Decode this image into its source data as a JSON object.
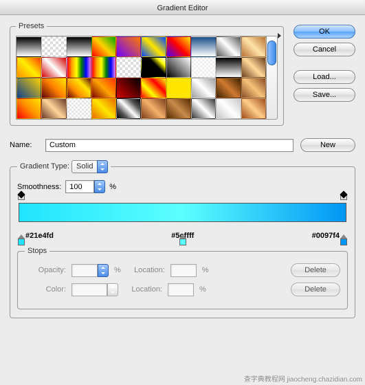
{
  "window": {
    "title": "Gradient Editor"
  },
  "presets": {
    "legend": "Presets"
  },
  "buttons": {
    "ok": "OK",
    "cancel": "Cancel",
    "load": "Load...",
    "save": "Save...",
    "new": "New",
    "delete": "Delete"
  },
  "name": {
    "label": "Name:",
    "value": "Custom"
  },
  "gtype": {
    "legend": "Gradient Type:",
    "value": "Solid"
  },
  "smoothness": {
    "label": "Smoothness:",
    "value": "100",
    "unit": "%"
  },
  "gradient": {
    "colors": [
      "#21e4fd",
      "#5cffff",
      "#0097f4"
    ],
    "labels": [
      "#21e4fd",
      "#5cffff",
      "#0097f4"
    ]
  },
  "stops": {
    "legend": "Stops",
    "opacity_label": "Opacity:",
    "color_label": "Color:",
    "location_label": "Location:",
    "opacity_value": "",
    "color_value": "",
    "loc1_value": "",
    "loc2_value": "",
    "unit": "%"
  },
  "footer": "查字典教程网 jiaocheng.chazidian.com",
  "swatch_css": [
    "linear-gradient(#000,#fff)",
    "repeating-conic-gradient(#fff 0 25%, #ddd 0 50%) 0/8px 8px",
    "linear-gradient(#000,#fff)",
    "linear-gradient(45deg,#ff0000,#ffd200,#00a600)",
    "linear-gradient(45deg,#6f00ff,#ff7a00)",
    "linear-gradient(45deg,#0044ff,#ffe600,#0044ff)",
    "linear-gradient(45deg,#4a00ff,#ff0000,#ffec00)",
    "linear-gradient(#1a4e8a,#fff)",
    "linear-gradient(45deg,#555,#fff 50%,#555)",
    "linear-gradient(45deg,#b87333,#ffe3aa,#b87333)",
    "linear-gradient(45deg,#ff8c00,#ffef00,#ff3c00)",
    "linear-gradient(45deg,#d30000,#fff,#d30000)",
    "linear-gradient(90deg,red,orange,yellow,green,blue,violet)",
    "linear-gradient(90deg,red,orange,yellow,green,blue,violet)",
    "repeating-conic-gradient(#fff 0 25%, #ddd 0 50%) 0/8px 8px",
    "linear-gradient(45deg,#000 60%,#ff0,#fff)",
    "linear-gradient(45deg,#000,#fff)",
    "repeating-conic-gradient(#fff 0 25%, #eee 0 50%) 0/6px 6px",
    "linear-gradient(#000,#fff)",
    "linear-gradient(45deg,#6b3e1b,#ffd99b,#6b3e1b)",
    "linear-gradient(45deg,#0a3f8f,#ffd100)",
    "linear-gradient(45deg,#5c0000,#ff7e00,#ffe600)",
    "linear-gradient(45deg,#5c0000,#ff8b00,#ffe600,#5c0000)",
    "linear-gradient(45deg,#7a0000,#ffa400,#ff2e00)",
    "linear-gradient(45deg,#d40000,#000)",
    "linear-gradient(45deg,red,yellow,red,yellow)",
    "#ffe600",
    "linear-gradient(45deg,#9b9b9b,#fff,#9b9b9b)",
    "linear-gradient(45deg,#3b2000,#cf7a2f,#3b2000)",
    "linear-gradient(45deg,#8a4b25,#f5c47b,#8a4b25)",
    "linear-gradient(45deg,#ff0000,#ff8f00,#ffe600)",
    "linear-gradient(45deg,#6a3824,#ffd59b,#6a3824)",
    "repeating-conic-gradient(#fff 0 25%, #e6e6e6 0 50%) 0/6px 6px",
    "linear-gradient(45deg,#e86b00,#ffe600,#e86b00)",
    "linear-gradient(45deg,#000,#555,#fff,#555,#000)",
    "linear-gradient(45deg,#7a3e1a,#f4b06a,#7a3e1a)",
    "linear-gradient(45deg,#572c00,#c98a4b,#572c00)",
    "linear-gradient(45deg,#333,#fff,#333)",
    "linear-gradient(45deg,#c6c6c6,#fff,#c6c6c6)",
    "linear-gradient(45deg,#a04d1e,#ffce88,#a04d1e)"
  ]
}
